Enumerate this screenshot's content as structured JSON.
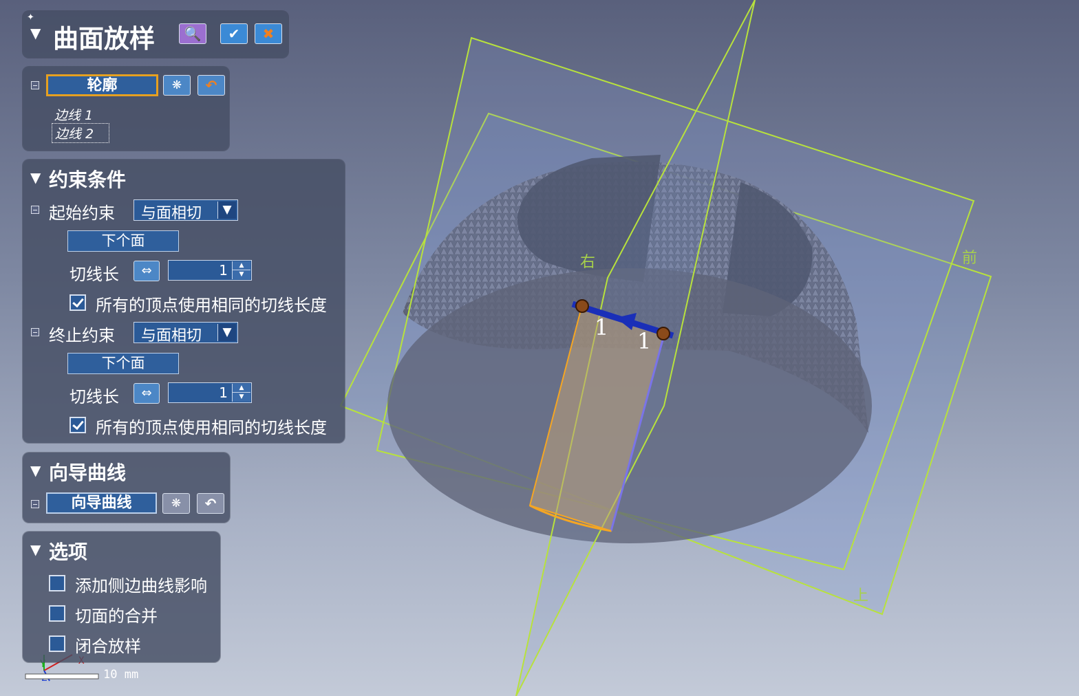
{
  "dialog": {
    "title": "曲面放样",
    "buttons": {
      "preview_icon": "magnifier-icon",
      "ok_icon": "checkmark-icon",
      "cancel_icon": "close-icon"
    }
  },
  "profile": {
    "select_label": "轮廓",
    "items": [
      "边线 1",
      "边线 2"
    ]
  },
  "constraints": {
    "heading": "约束条件",
    "start": {
      "label": "起始约束",
      "dropdown_value": "与面相切",
      "next_face_button": "下个面",
      "tangent_length_label": "切线长",
      "tangent_length_value": "1",
      "same_length_checkbox_label": "所有的顶点使用相同的切线长度",
      "same_length_checked": true
    },
    "end": {
      "label": "终止约束",
      "dropdown_value": "与面相切",
      "next_face_button": "下个面",
      "tangent_length_label": "切线长",
      "tangent_length_value": "1",
      "same_length_checkbox_label": "所有的顶点使用相同的切线长度",
      "same_length_checked": true
    }
  },
  "guide_curves": {
    "heading": "向导曲线",
    "select_label": "向导曲线"
  },
  "options": {
    "heading": "选项",
    "items": [
      {
        "label": "添加侧边曲线影响",
        "checked": false
      },
      {
        "label": "切面的合并",
        "checked": false
      },
      {
        "label": "闭合放样",
        "checked": false
      }
    ]
  },
  "viewport": {
    "plane_labels": {
      "right": "右",
      "front": "前",
      "top": "上"
    },
    "tangent_markers": [
      "1",
      "1"
    ],
    "scale_text": "10 mm",
    "triad_labels": {
      "x": "X",
      "y": "Y",
      "z": "Z"
    },
    "colors": {
      "plane": "#b8e23c",
      "highlight_edge": "#f5a623",
      "arrow": "#1a2fb8",
      "panel_button": "#2f5f9c"
    }
  }
}
